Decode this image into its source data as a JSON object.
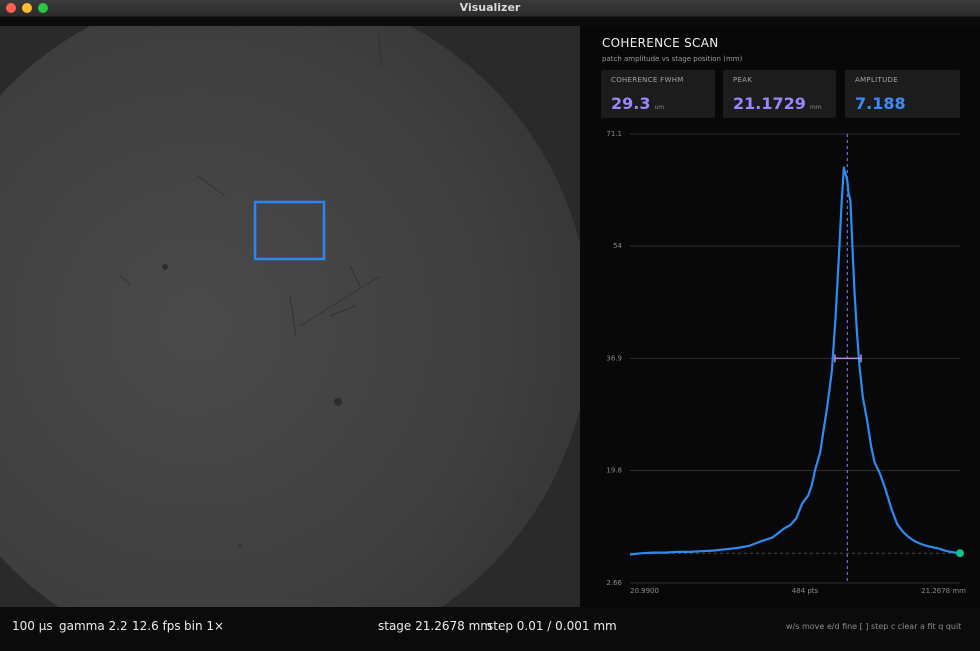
{
  "window": {
    "title": "Visualizer"
  },
  "panel": {
    "title": "COHERENCE SCAN",
    "subtitle": "patch amplitude vs stage position (mm)",
    "cards": [
      {
        "label": "COHERENCE FWHM",
        "value": "29.3",
        "unit": "um",
        "color": "#9b86ff"
      },
      {
        "label": "PEAK",
        "value": "21.1729",
        "unit": "mm",
        "color": "#9b86ff"
      },
      {
        "label": "AMPLITUDE",
        "value": "7.188",
        "unit": "",
        "color": "#3b8bff"
      }
    ]
  },
  "chart_data": {
    "type": "line",
    "title": "COHERENCE SCAN",
    "xlabel": "",
    "ylabel": "",
    "y_ticks": [
      "71.1",
      "54",
      "36.9",
      "19.8",
      "2.66"
    ],
    "ylim": [
      2.66,
      71.1
    ],
    "x_labels": {
      "left": "20.9900",
      "center": "484 pts",
      "right": "21.2678 mm"
    },
    "xlim": [
      20.99,
      21.2678
    ],
    "grid": true,
    "series_color": "#2f8bf0",
    "peak_marker_color": "#8f7aff",
    "fwhm_color": "#b48cf0",
    "baseline": 7.2,
    "peak_x": 21.1729,
    "fwhm_level": 36.9,
    "fwhm_range": [
      21.1625,
      21.1845
    ],
    "current_point": {
      "x": 21.2678,
      "y": 7.2,
      "color": "#14c08a"
    },
    "series": [
      {
        "x": [
          20.99,
          21.0,
          21.01,
          21.02,
          21.03,
          21.04,
          21.05,
          21.06,
          21.07,
          21.08,
          21.09,
          21.1,
          21.11,
          21.115,
          21.12,
          21.125,
          21.13,
          21.135,
          21.14,
          21.143,
          21.146,
          21.15,
          21.153,
          21.156,
          21.16,
          21.163,
          21.166,
          21.168,
          21.17,
          21.1715,
          21.1729,
          21.174,
          21.1755,
          21.177,
          21.179,
          21.181,
          21.183,
          21.186,
          21.19,
          21.193,
          21.196,
          21.2,
          21.205,
          21.21,
          21.215,
          21.22,
          21.225,
          21.23,
          21.235,
          21.24,
          21.245,
          21.25,
          21.255,
          21.26,
          21.2678
        ],
        "y": [
          7.0,
          7.2,
          7.3,
          7.3,
          7.4,
          7.4,
          7.5,
          7.6,
          7.8,
          8.0,
          8.3,
          9.0,
          9.6,
          10.3,
          11.0,
          11.5,
          12.5,
          14.8,
          16.0,
          17.5,
          20.0,
          22.5,
          26.0,
          29.5,
          35.0,
          43.0,
          53.0,
          60.0,
          66.0,
          65.0,
          64.0,
          62.0,
          61.0,
          55.0,
          47.0,
          41.0,
          36.0,
          31.0,
          27.0,
          23.5,
          21.0,
          19.5,
          17.0,
          14.0,
          11.6,
          10.4,
          9.6,
          9.0,
          8.6,
          8.3,
          8.1,
          7.9,
          7.6,
          7.4,
          7.2
        ]
      }
    ]
  },
  "status": {
    "exposure": "100 µs",
    "gamma": "gamma 2.2",
    "fps": "12.6 fps",
    "bin": "bin 1×",
    "stage": "stage 21.2678 mm",
    "step": "step 0.01 / 0.001 mm",
    "keys": "w/s move  e/d fine  [ ] step  c clear  a fit  q quit"
  }
}
